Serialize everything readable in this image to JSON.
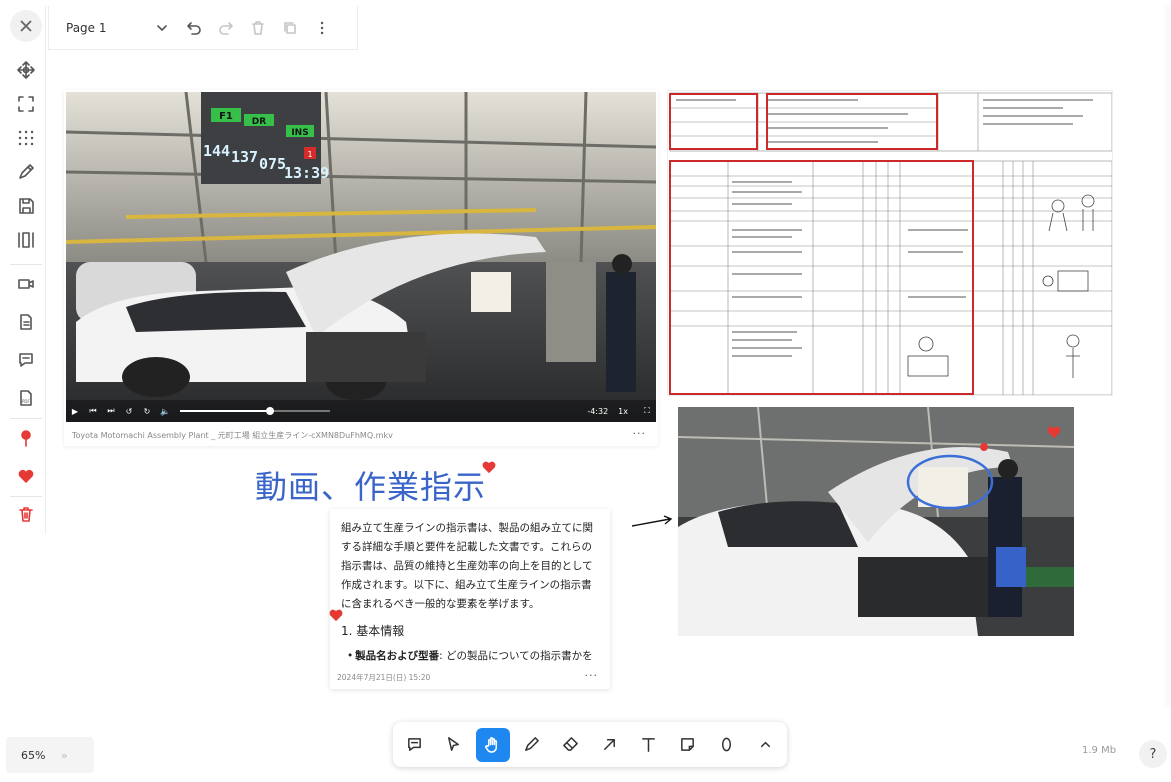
{
  "page": {
    "name": "Page 1"
  },
  "video": {
    "filename": "Toyota Motomachi Assembly Plant _ 元町工場 組立生産ライン-cXMN8DuFhMQ.mkv",
    "time_remaining": "-4:32",
    "speed": "1x",
    "progress": 0.6,
    "board": {
      "labels": [
        "F1",
        "DR",
        "INS"
      ],
      "values": [
        "144",
        "137",
        "075",
        "13:39"
      ],
      "badge": "1"
    }
  },
  "heading": "動画、作業指示",
  "text_card": {
    "paragraph": "組み立て生産ラインの指示書は、製品の組み立てに関する詳細な手順と要件を記載した文書です。これらの指示書は、品質の維持と生産効率の向上を目的として作成されます。以下に、組み立て生産ラインの指示書に含まれるべき一般的な要素を挙げます。",
    "section_heading": "1. 基本情報",
    "item_bold": "製品名および型番",
    "item_text": ": どの製品についての指示書かを明確にします",
    "date": "2024年7月21日(日) 15:20"
  },
  "status": {
    "zoom": "65%",
    "file_size": "1.9 Mb",
    "help": "?"
  },
  "icons": {
    "sidebar": [
      "close-icon",
      "move-icon",
      "fit-icon",
      "grid-icon",
      "pen-icon",
      "save-icon",
      "columns-icon",
      "video-icon",
      "document-icon",
      "comment-icon",
      "pdf-icon",
      "pin-icon",
      "heart-icon",
      "trash-icon"
    ],
    "toolbar": [
      "comment-tool-icon",
      "select-tool-icon",
      "hand-tool-icon",
      "pencil-tool-icon",
      "eraser-tool-icon",
      "arrow-tool-icon",
      "text-tool-icon",
      "sticky-note-tool-icon",
      "shape-tool-icon",
      "expand-icon"
    ]
  },
  "colors": {
    "accent": "#1e88f0",
    "heading": "#3a64c8",
    "highlight_red": "#cc2a2a",
    "heart": "#e53935",
    "annotation_blue": "#3b6fd8"
  }
}
